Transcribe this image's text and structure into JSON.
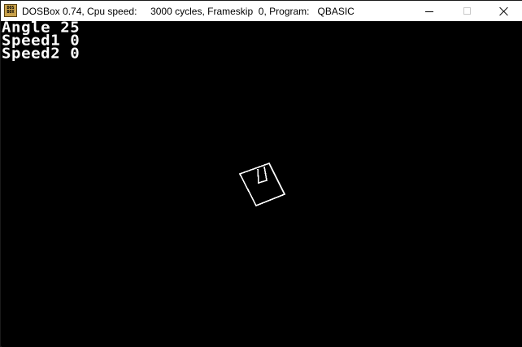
{
  "window": {
    "title": "DOSBox 0.74, Cpu speed:     3000 cycles, Frameskip  0, Program:   QBASIC",
    "icon_name": "dosbox-icon",
    "icon_text_top": "DOS",
    "icon_text_bottom": "BOX"
  },
  "controls": {
    "minimize": "minimize-icon",
    "maximize": "maximize-icon",
    "close": "close-icon"
  },
  "screen": {
    "lines": [
      {
        "label": "Angle",
        "value": "25",
        "text": "Angle 25"
      },
      {
        "label": "Speed1",
        "value": "0",
        "text": "Speed1 0"
      },
      {
        "label": "Speed2",
        "value": "0",
        "text": "Speed2 0"
      }
    ],
    "foreground": "#ffffff",
    "background": "#000000"
  }
}
